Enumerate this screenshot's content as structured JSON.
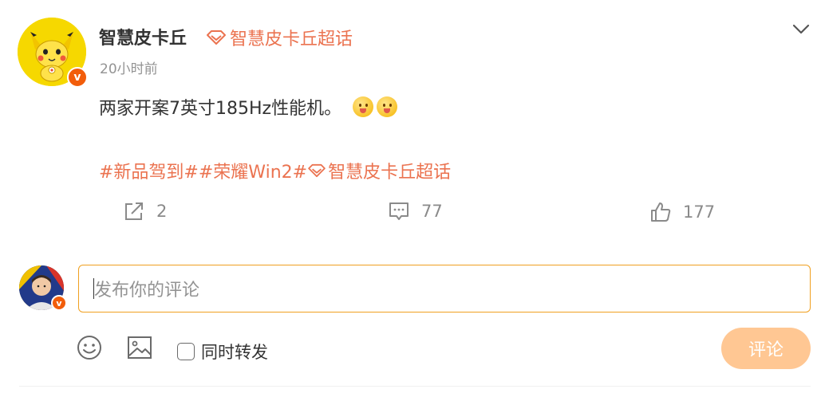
{
  "post": {
    "author": "智慧皮卡丘",
    "supertopic_label": "智慧皮卡丘超话",
    "timestamp": "20小时前",
    "text": "两家开案7英寸185Hz性能机。",
    "emojis": [
      "tongue-out-emoji",
      "tongue-out-emoji"
    ],
    "tags": [
      {
        "text": "#新品驾到#"
      },
      {
        "text": "#荣耀Win2#"
      },
      {
        "text": "智慧皮卡丘超话"
      }
    ],
    "verified_badge": "v"
  },
  "actions": {
    "repost_count": "2",
    "comment_count": "77",
    "like_count": "177"
  },
  "comment": {
    "placeholder": "发布你的评论",
    "repost_option_label": "同时转发",
    "submit_label": "评论",
    "user_badge": "v"
  },
  "colors": {
    "accent": "#eb7350",
    "badge": "#f25d0b",
    "input_border": "#f0a020",
    "submit_bg": "#ffc793",
    "muted": "#939393"
  }
}
